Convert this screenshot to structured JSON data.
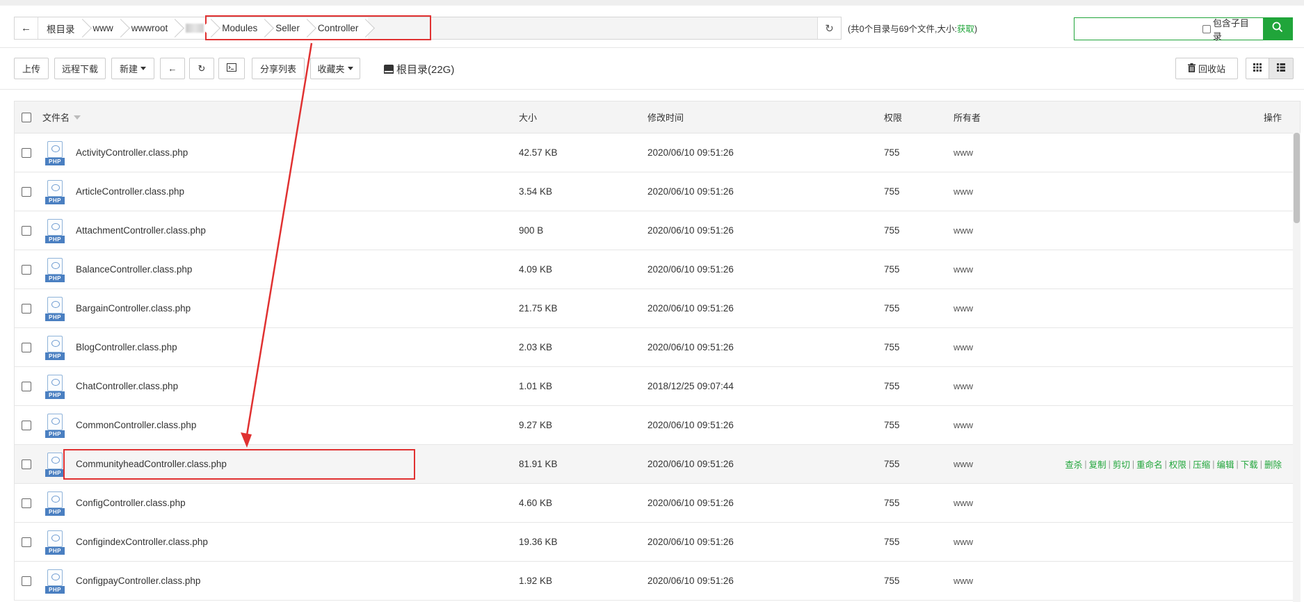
{
  "address_bar": {
    "crumbs": [
      "根目录",
      "www",
      "wwwroot",
      "",
      "Modules",
      "Seller",
      "Controller"
    ],
    "summary_prefix": "(共0个目录与69个文件,大小:",
    "summary_link": "获取",
    "summary_suffix": ")"
  },
  "search": {
    "placeholder": "",
    "include_subdir_label": "包含子目录"
  },
  "toolbar": {
    "upload": "上传",
    "remote_download": "远程下载",
    "new": "新建",
    "share_list": "分享列表",
    "favorites": "收藏夹",
    "disk_label": "根目录(22G)",
    "recycle_bin": "回收站"
  },
  "table": {
    "headers": {
      "name": "文件名",
      "size": "大小",
      "modified": "修改时间",
      "perm": "权限",
      "owner": "所有者",
      "ops": "操作"
    },
    "rows": [
      {
        "name": "ActivityController.class.php",
        "size": "42.57 KB",
        "modified": "2020/06/10 09:51:26",
        "perm": "755",
        "owner": "www"
      },
      {
        "name": "ArticleController.class.php",
        "size": "3.54 KB",
        "modified": "2020/06/10 09:51:26",
        "perm": "755",
        "owner": "www"
      },
      {
        "name": "AttachmentController.class.php",
        "size": "900 B",
        "modified": "2020/06/10 09:51:26",
        "perm": "755",
        "owner": "www"
      },
      {
        "name": "BalanceController.class.php",
        "size": "4.09 KB",
        "modified": "2020/06/10 09:51:26",
        "perm": "755",
        "owner": "www"
      },
      {
        "name": "BargainController.class.php",
        "size": "21.75 KB",
        "modified": "2020/06/10 09:51:26",
        "perm": "755",
        "owner": "www"
      },
      {
        "name": "BlogController.class.php",
        "size": "2.03 KB",
        "modified": "2020/06/10 09:51:26",
        "perm": "755",
        "owner": "www"
      },
      {
        "name": "ChatController.class.php",
        "size": "1.01 KB",
        "modified": "2018/12/25 09:07:44",
        "perm": "755",
        "owner": "www"
      },
      {
        "name": "CommonController.class.php",
        "size": "9.27 KB",
        "modified": "2020/06/10 09:51:26",
        "perm": "755",
        "owner": "www"
      },
      {
        "name": "CommunityheadController.class.php",
        "size": "81.91 KB",
        "modified": "2020/06/10 09:51:26",
        "perm": "755",
        "owner": "www"
      },
      {
        "name": "ConfigController.class.php",
        "size": "4.60 KB",
        "modified": "2020/06/10 09:51:26",
        "perm": "755",
        "owner": "www"
      },
      {
        "name": "ConfigindexController.class.php",
        "size": "19.36 KB",
        "modified": "2020/06/10 09:51:26",
        "perm": "755",
        "owner": "www"
      },
      {
        "name": "ConfigpayController.class.php",
        "size": "1.92 KB",
        "modified": "2020/06/10 09:51:26",
        "perm": "755",
        "owner": "www"
      }
    ],
    "file_icon_label": "PHP",
    "row_actions": [
      "查杀",
      "复制",
      "剪切",
      "重命名",
      "权限",
      "压缩",
      "编辑",
      "下载",
      "删除"
    ]
  },
  "colors": {
    "accent": "#20a53a",
    "highlight_box": "#e03131"
  }
}
